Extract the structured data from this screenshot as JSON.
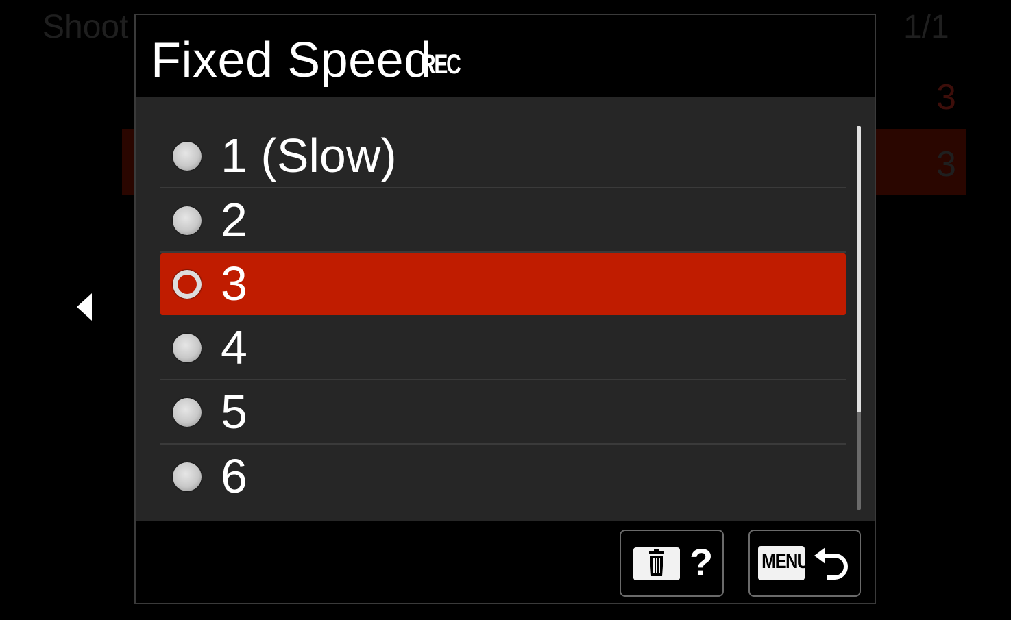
{
  "background": {
    "menu_title": "Shoot",
    "page_indicator": "1/1",
    "row1_value": "3",
    "row2_value": "3"
  },
  "dialog": {
    "title": "Fixed Speed",
    "mode_badge": "REC",
    "options": [
      {
        "label": "1 (Slow)",
        "selected": false
      },
      {
        "label": "2",
        "selected": false
      },
      {
        "label": "3",
        "selected": true
      },
      {
        "label": "4",
        "selected": false
      },
      {
        "label": "5",
        "selected": false
      },
      {
        "label": "6",
        "selected": false
      }
    ],
    "buttons": {
      "help_label": "?",
      "menu_label": "MENU"
    },
    "icons": {
      "delete": "trash-icon",
      "back": "return-arrow-icon",
      "nav_left": "left-arrow-icon"
    },
    "colors": {
      "selected_row": "#c01c00",
      "list_background": "#262626"
    }
  }
}
